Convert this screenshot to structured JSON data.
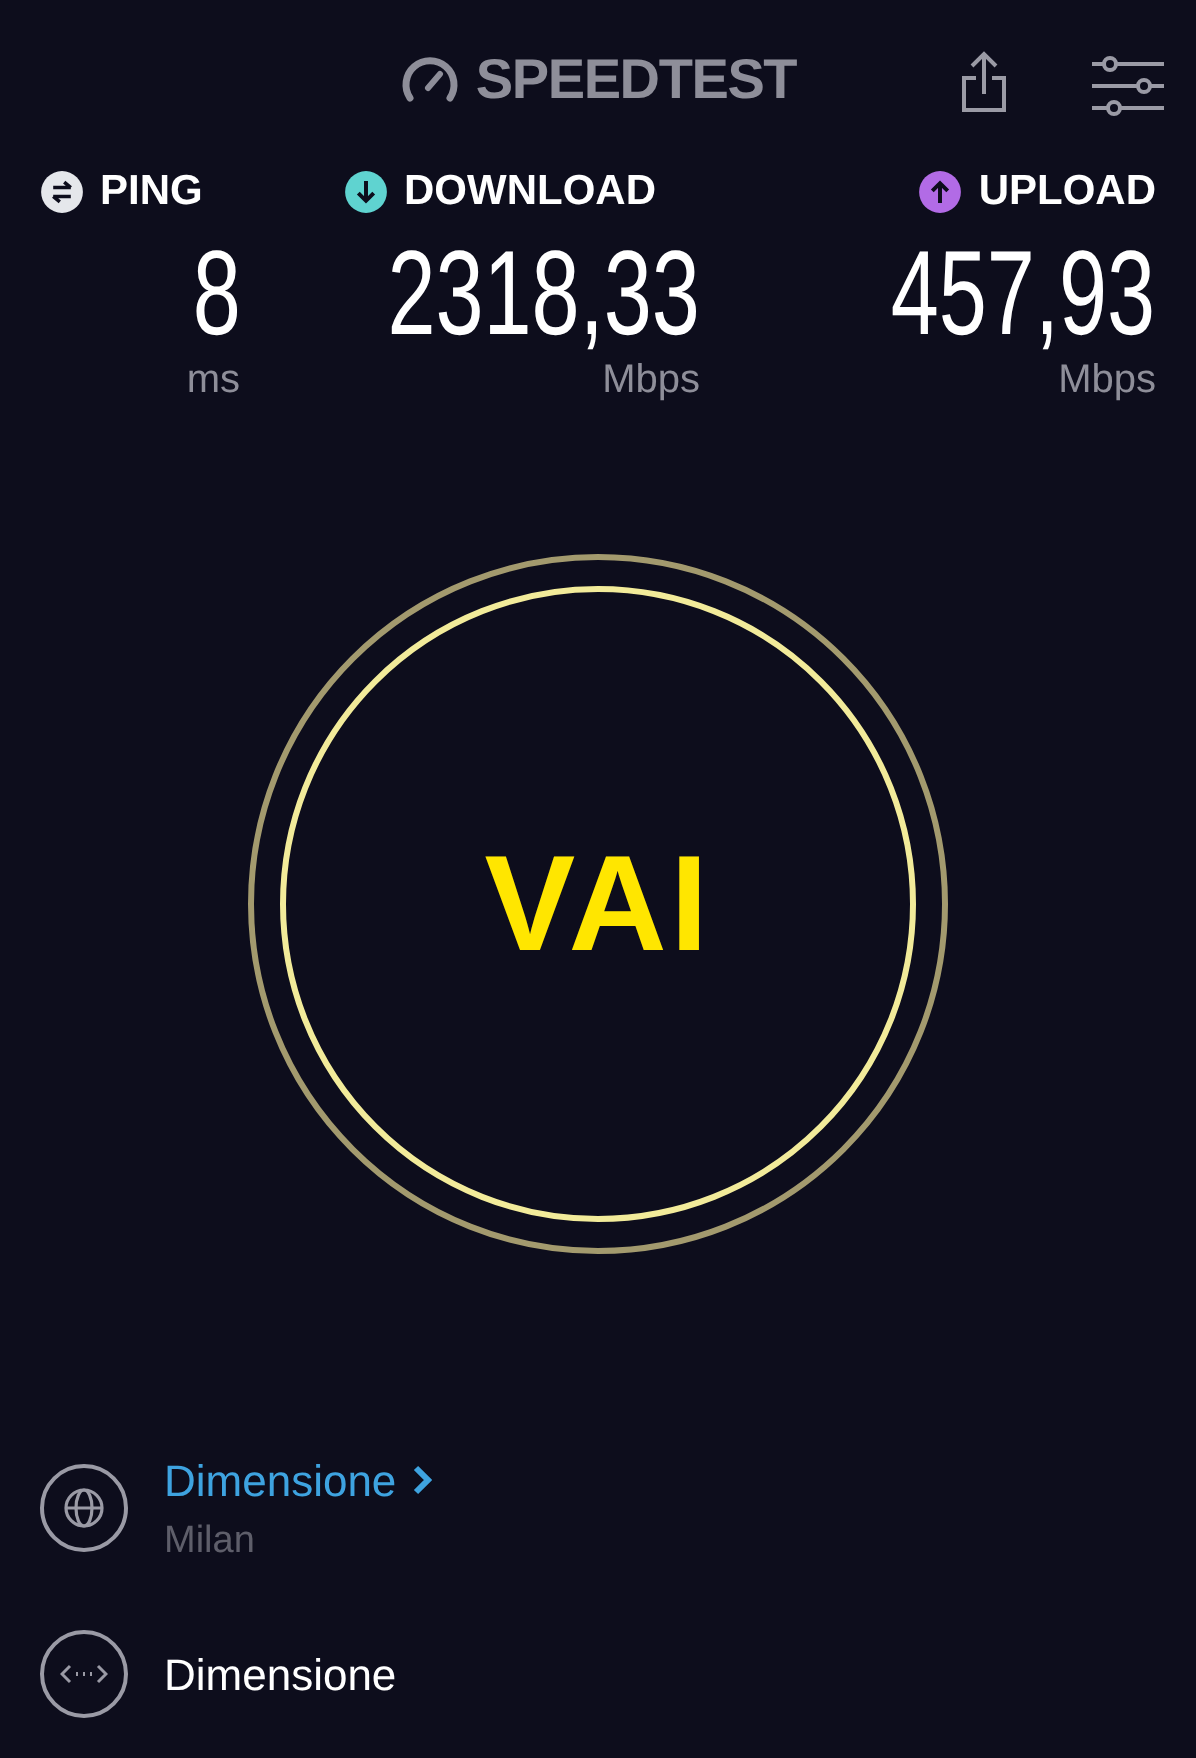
{
  "header": {
    "logo": "SPEEDTEST"
  },
  "metrics": [
    {
      "kind": "ping",
      "label": "PING",
      "value": "8",
      "unit": "ms",
      "color": "#e5e7eb"
    },
    {
      "kind": "download",
      "label": "DOWNLOAD",
      "value": "2318,33",
      "unit": "Mbps",
      "color": "#5fd3d0"
    },
    {
      "kind": "upload",
      "label": "UPLOAD",
      "value": "457,93",
      "unit": "Mbps",
      "color": "#b26be6"
    }
  ],
  "go_button": {
    "label": "VAI"
  },
  "servers": [
    {
      "kind": "isp",
      "name": "Dimensione",
      "location": "Milan"
    },
    {
      "kind": "connection",
      "name": "Dimensione"
    }
  ]
}
